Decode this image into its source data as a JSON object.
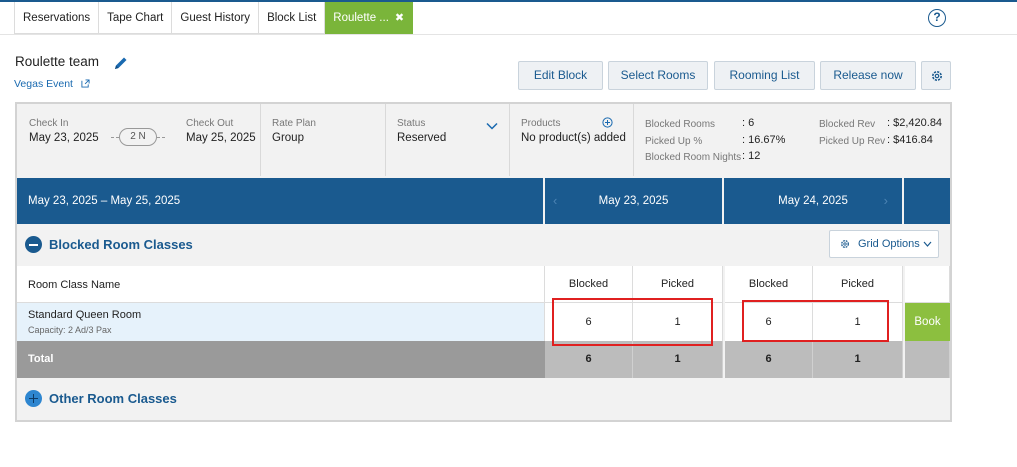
{
  "tabs": [
    {
      "label": "Reservations"
    },
    {
      "label": "Tape Chart"
    },
    {
      "label": "Guest History"
    },
    {
      "label": "Block List"
    },
    {
      "label": "Roulette ...",
      "active": true
    }
  ],
  "help_label": "?",
  "header": {
    "title": "Roulette team",
    "event_link": "Vegas Event"
  },
  "actions": {
    "edit_block": "Edit Block",
    "select_rooms": "Select Rooms",
    "rooming_list": "Rooming List",
    "release_now": "Release now"
  },
  "summary": {
    "check_in_label": "Check In",
    "check_in": "May 23, 2025",
    "nights": "2 N",
    "check_out_label": "Check Out",
    "check_out": "May 25, 2025",
    "rate_plan_label": "Rate Plan",
    "rate_plan": "Group",
    "status_label": "Status",
    "status": "Reserved",
    "products_label": "Products",
    "products": "No product(s) added",
    "blocked_rooms_label": "Blocked Rooms",
    "blocked_rooms": ": 6",
    "picked_up_pct_label": "Picked Up %",
    "picked_up_pct": ": 16.67%",
    "blocked_room_nights_label": "Blocked Room Nights",
    "blocked_room_nights": ": 12",
    "blocked_rev_label": "Blocked Rev",
    "blocked_rev": ": $2,420.84",
    "picked_up_rev_label": "Picked Up Rev",
    "picked_up_rev": ": $416.84"
  },
  "date_band": {
    "range": "May 23, 2025 – May 25, 2025",
    "day1": "May 23, 2025",
    "day2": "May 24, 2025"
  },
  "blocked_section": {
    "title": "Blocked Room Classes",
    "grid_options": "Grid Options"
  },
  "table": {
    "col_name": "Room Class Name",
    "col_blocked": "Blocked",
    "col_picked": "Picked",
    "row": {
      "name": "Standard Queen Room",
      "capacity": "Capacity: 2 Ad/3 Pax",
      "day1_blocked": "6",
      "day1_picked": "1",
      "day2_blocked": "6",
      "day2_picked": "1",
      "book": "Book"
    },
    "total": {
      "label": "Total",
      "day1_blocked": "6",
      "day1_picked": "1",
      "day2_blocked": "6",
      "day2_picked": "1"
    }
  },
  "other_section": {
    "title": "Other Room Classes"
  },
  "colors": {
    "brand_blue": "#1a5a8f",
    "active_tab_green": "#7ab53a",
    "book_green": "#8cbf3f",
    "highlight_red": "#e02020"
  }
}
